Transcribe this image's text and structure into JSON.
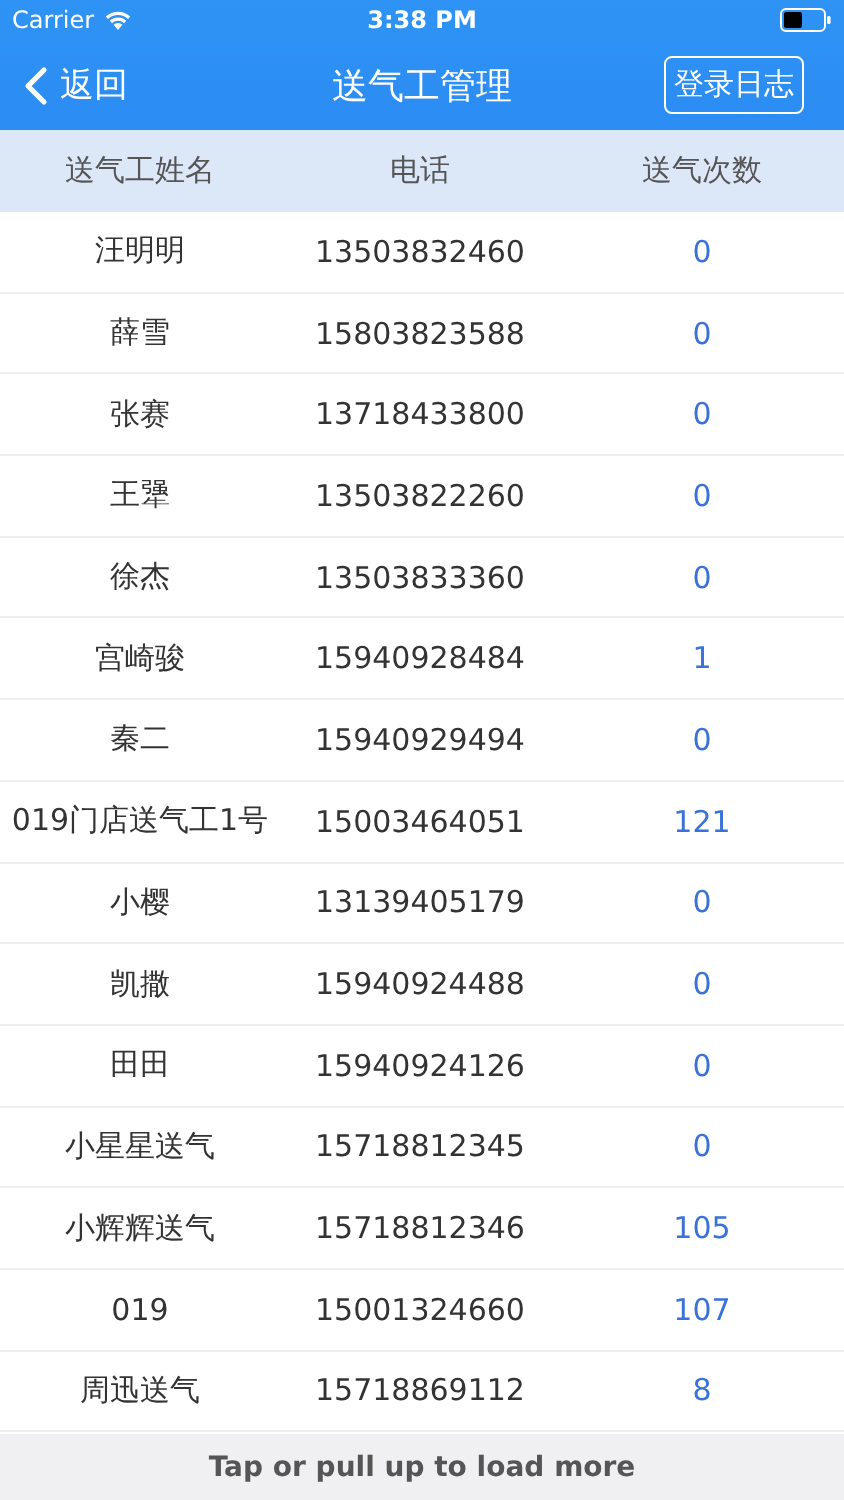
{
  "status_bar": {
    "carrier": "Carrier",
    "time": "3:38 PM"
  },
  "nav": {
    "back": "返回",
    "title": "送气工管理",
    "action": "登录日志"
  },
  "table": {
    "columns": [
      "送气工姓名",
      "电话",
      "送气次数"
    ],
    "rows": [
      {
        "name": "汪明明",
        "phone": "13503832460",
        "count": "0"
      },
      {
        "name": "薛雪",
        "phone": "15803823588",
        "count": "0"
      },
      {
        "name": "张赛",
        "phone": "13718433800",
        "count": "0"
      },
      {
        "name": "王犟",
        "phone": "13503822260",
        "count": "0"
      },
      {
        "name": "徐杰",
        "phone": "13503833360",
        "count": "0"
      },
      {
        "name": "宫崎骏",
        "phone": "15940928484",
        "count": "1"
      },
      {
        "name": "秦二",
        "phone": "15940929494",
        "count": "0"
      },
      {
        "name": "019门店送气工1号",
        "phone": "15003464051",
        "count": "121"
      },
      {
        "name": "小樱",
        "phone": "13139405179",
        "count": "0"
      },
      {
        "name": "凯撒",
        "phone": "15940924488",
        "count": "0"
      },
      {
        "name": "田田",
        "phone": "15940924126",
        "count": "0"
      },
      {
        "name": "小星星送气",
        "phone": "15718812345",
        "count": "0"
      },
      {
        "name": "小辉辉送气",
        "phone": "15718812346",
        "count": "105"
      },
      {
        "name": "019",
        "phone": "15001324660",
        "count": "107"
      },
      {
        "name": "周迅送气",
        "phone": "15718869112",
        "count": "8"
      }
    ]
  },
  "footer": "Tap or pull up to load more"
}
